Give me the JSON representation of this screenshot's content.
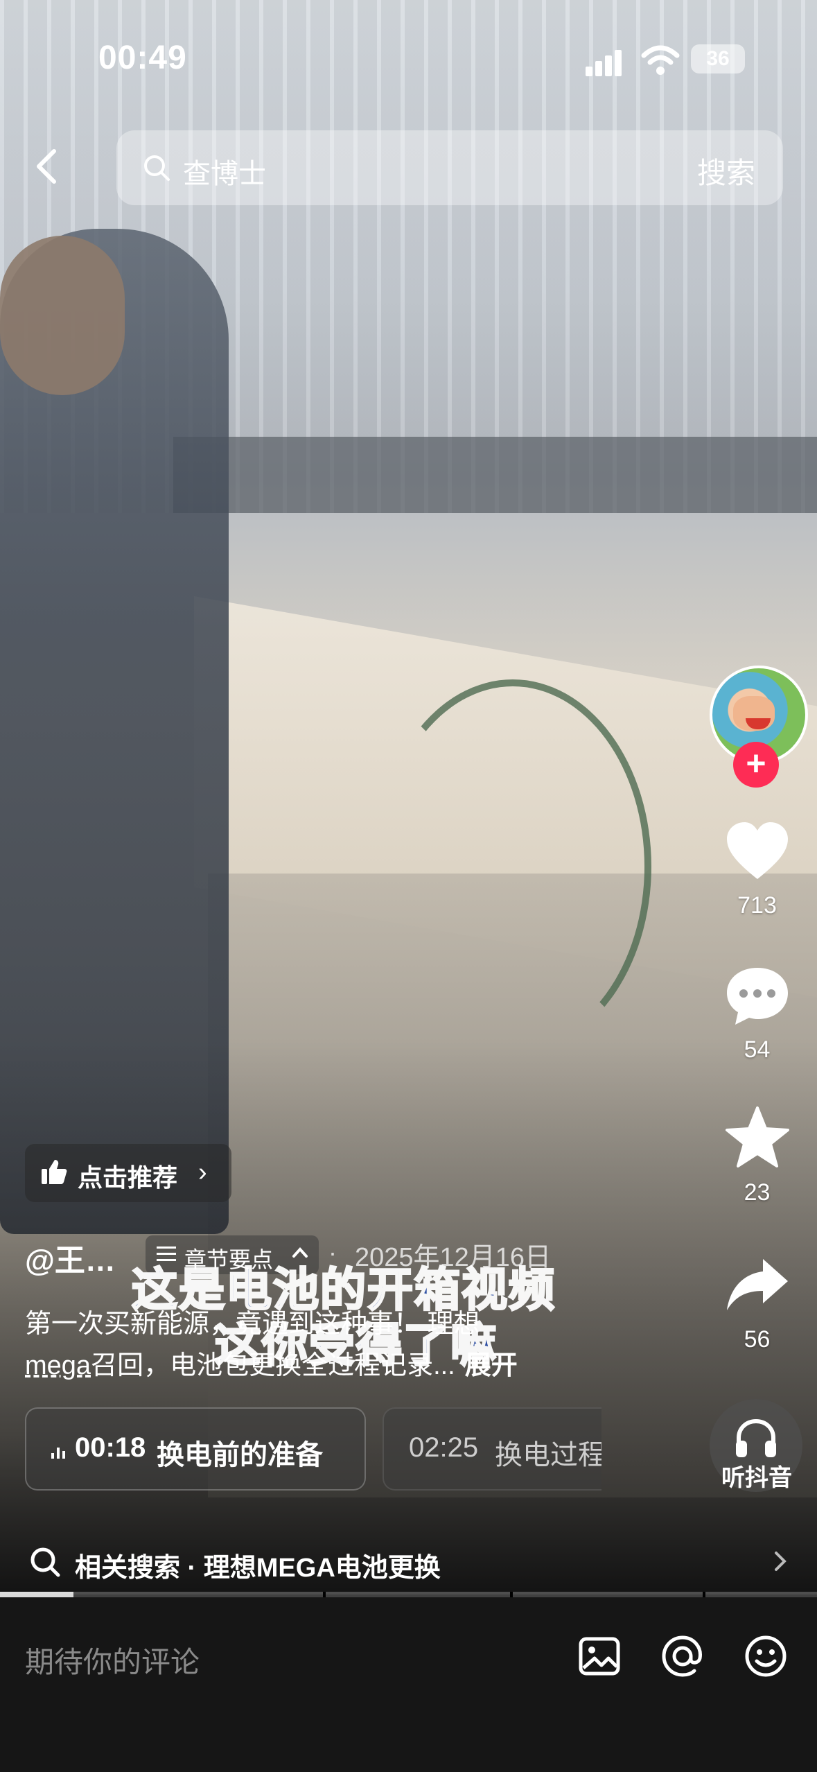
{
  "status_bar": {
    "time": "00:49",
    "battery": "36"
  },
  "search": {
    "placeholder": "查博士",
    "button": "搜索"
  },
  "video": {
    "subtitle_line1": "这是电池的开箱视频",
    "subtitle_line2": "这你受得了嘛"
  },
  "actions": {
    "likes": "713",
    "comments": "54",
    "favorites": "23",
    "shares": "56",
    "listen_label": "听抖音"
  },
  "recommend": {
    "label": "点击推荐"
  },
  "post": {
    "author": "@王…",
    "chapter_label": "章节要点",
    "date": "2025年12月16日",
    "separator": "·",
    "desc_prefix": "第一次买新能源，竟遇到这种事！ 理想",
    "desc_tag": "mega",
    "desc_suffix": "召回，电池包更换全过程记录...",
    "expand": "展开"
  },
  "chapters": [
    {
      "time": "00:18",
      "label": "换电前的准备"
    },
    {
      "time": "02:25",
      "label": "换电过程"
    }
  ],
  "related": {
    "text": "相关搜索 · 理想MEGA电池更换"
  },
  "progress": {
    "fraction": 0.09
  },
  "comment": {
    "placeholder": "期待你的评论"
  },
  "colors": {
    "follow": "#fe2c55",
    "bar_bg": "#161616"
  },
  "icons": [
    "back-icon",
    "search-icon",
    "heart-icon",
    "comment-icon",
    "star-icon",
    "share-icon",
    "headphones-icon",
    "thumbs-up-icon",
    "image-icon",
    "at-icon",
    "emoji-icon"
  ]
}
